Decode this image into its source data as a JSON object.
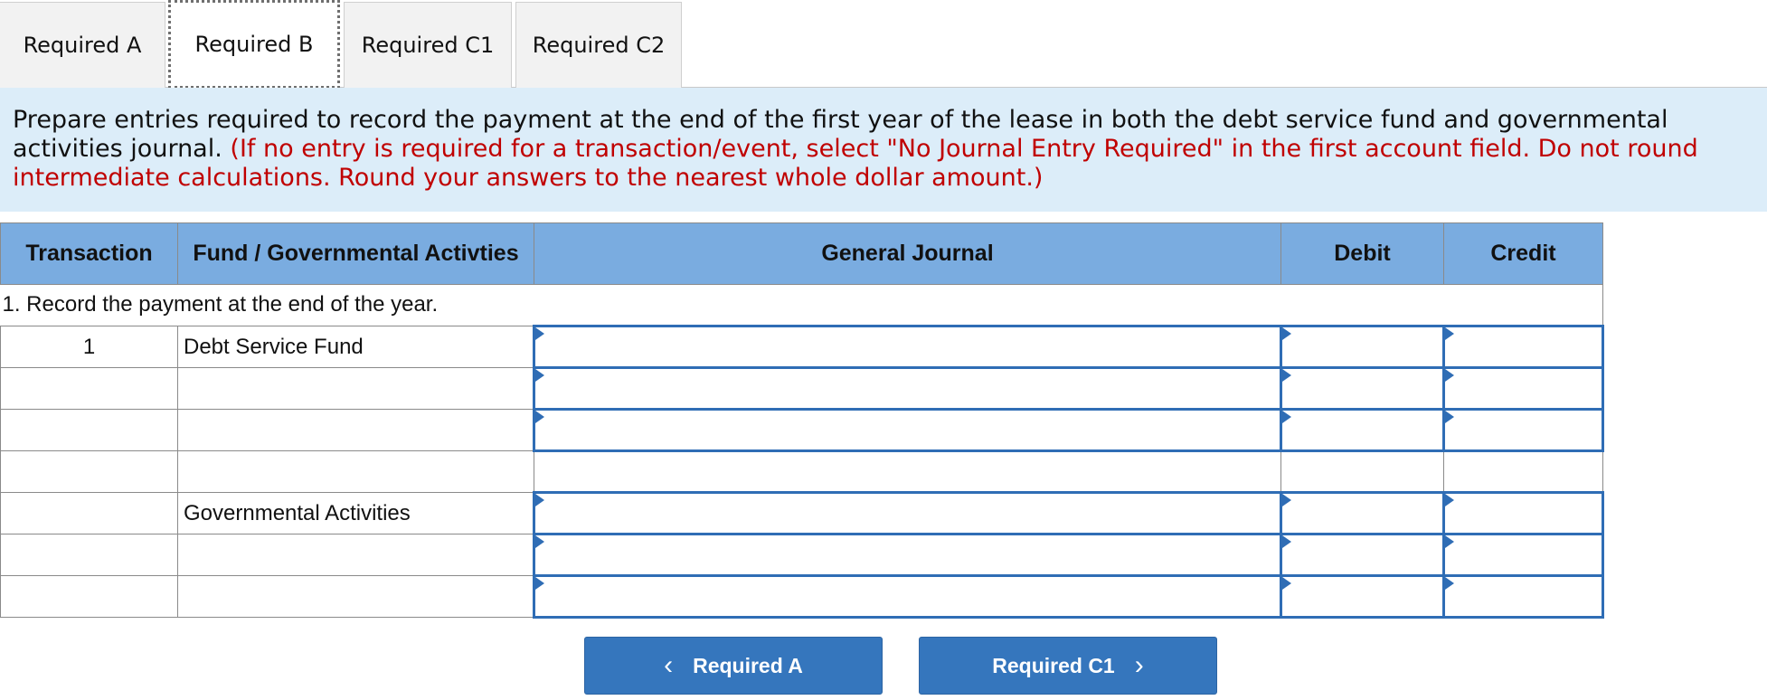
{
  "tabs": [
    {
      "label": "Required A"
    },
    {
      "label": "Required B"
    },
    {
      "label": "Required C1"
    },
    {
      "label": "Required C2"
    }
  ],
  "active_tab": "Required B",
  "instructions": {
    "main": "Prepare entries required to record the payment at the end of the first year of the lease in both the debt service fund and governmental activities journal.",
    "note": "(If no entry is required for a transaction/event, select \"No Journal Entry Required\" in the first account field. Do not round intermediate calculations. Round your answers to the nearest whole dollar amount.)"
  },
  "table": {
    "headers": [
      "Transaction",
      "Fund / Governmental Activties",
      "General Journal",
      "Debit",
      "Credit"
    ],
    "description": "1. Record the payment at the end of the year.",
    "rows": [
      {
        "transaction": "1",
        "fund": "Debt Service Fund",
        "editable": true
      },
      {
        "transaction": "",
        "fund": "",
        "editable": true
      },
      {
        "transaction": "",
        "fund": "",
        "editable": true
      },
      {
        "transaction": "",
        "fund": "",
        "editable": false
      },
      {
        "transaction": "",
        "fund": "Governmental Activities",
        "editable": true
      },
      {
        "transaction": "",
        "fund": "",
        "editable": true
      },
      {
        "transaction": "",
        "fund": "",
        "editable": true
      }
    ]
  },
  "nav": {
    "prev_label": "Required A",
    "next_label": "Required C1"
  },
  "colors": {
    "header_bg": "#7aace0",
    "instructions_bg": "#dcedf9",
    "note_text": "#c00000",
    "button_bg": "#3576bd",
    "entry_border": "#2f6db5"
  },
  "icons": {
    "prev": "chevron-left-icon",
    "next": "chevron-right-icon"
  }
}
